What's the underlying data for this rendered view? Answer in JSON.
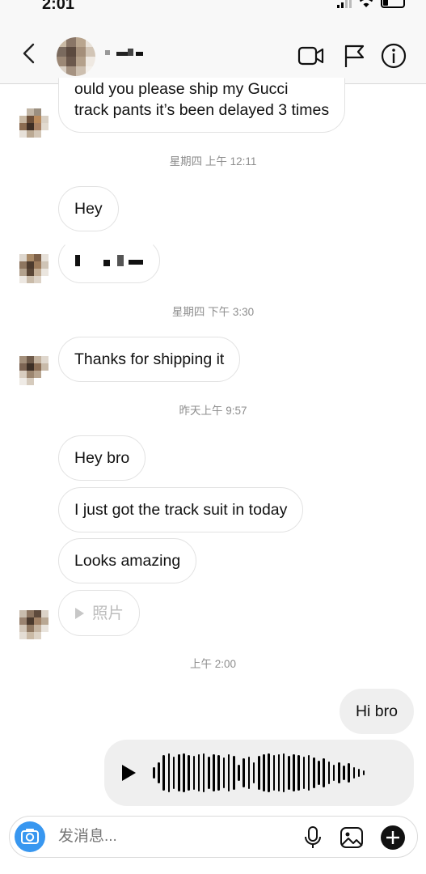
{
  "status_bar": {
    "time": "2:01"
  },
  "header": {
    "name": ""
  },
  "messages": [
    {
      "id": "m0",
      "side": "them",
      "lines": [
        "ould you please ship my Gucci",
        "track pants it’s been delayed 3 times"
      ]
    },
    {
      "id": "m1",
      "side": "them",
      "text": "Hey"
    },
    {
      "id": "m2",
      "side": "them",
      "text": ""
    },
    {
      "id": "m3",
      "side": "them",
      "text": "Thanks for shipping it"
    },
    {
      "id": "m4",
      "side": "them",
      "text": "Hey bro"
    },
    {
      "id": "m5",
      "side": "them",
      "text": "I just got the track suit in today"
    },
    {
      "id": "m6",
      "side": "them",
      "text": "Looks amazing"
    },
    {
      "id": "m7",
      "side": "them",
      "type": "photo",
      "text": "照片"
    },
    {
      "id": "m8",
      "side": "me",
      "text": "Hi bro"
    },
    {
      "id": "m9",
      "side": "me",
      "type": "voice"
    }
  ],
  "timestamps": [
    "星期四 上午 12:11",
    "星期四 下午 3:30",
    "昨天上午 9:57",
    "上午 2:00"
  ],
  "composer": {
    "placeholder": "发消息..."
  },
  "icons": {
    "header": [
      "back-icon",
      "video-call-icon",
      "flag-icon",
      "info-icon"
    ],
    "composer": [
      "camera-icon",
      "microphone-icon",
      "gallery-icon",
      "add-icon"
    ]
  },
  "colors": {
    "accent": "#3897f0",
    "my_bubble": "#efefef",
    "timestamp": "#8e8e8e"
  }
}
